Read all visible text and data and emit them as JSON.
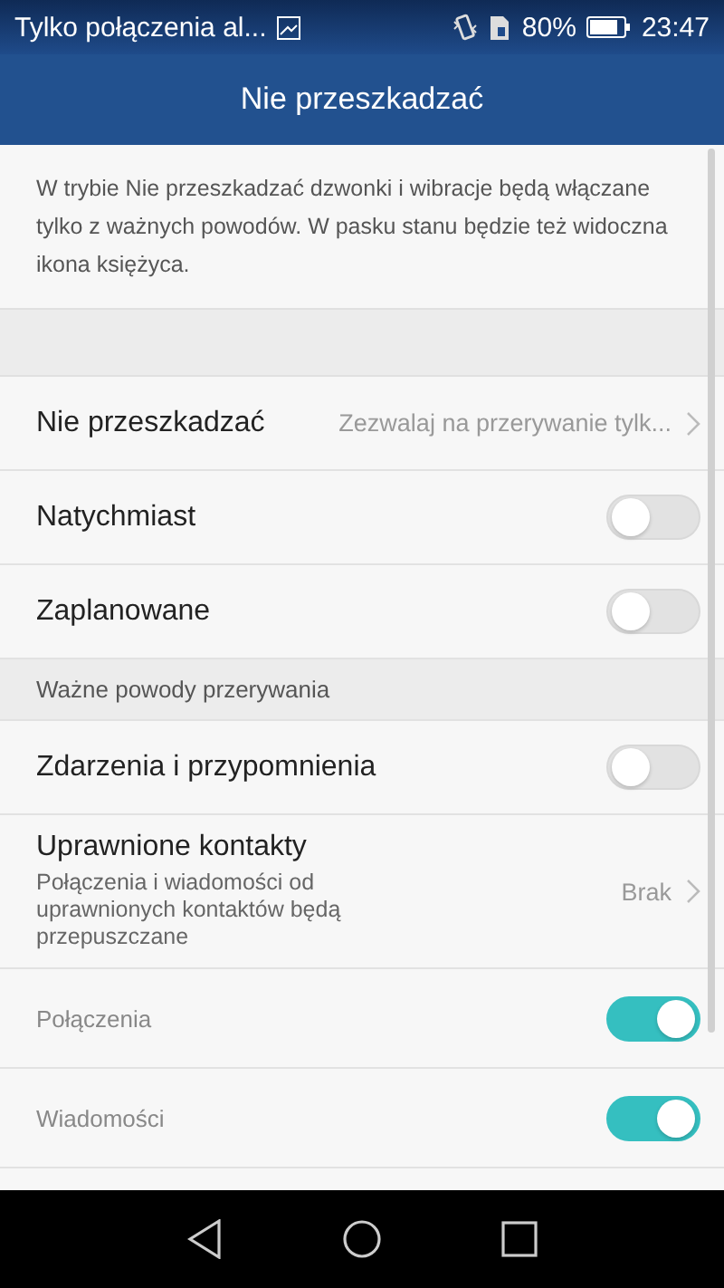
{
  "status_bar": {
    "notification": "Tylko połączenia al...",
    "battery": "80%",
    "time": "23:47"
  },
  "header": {
    "title": "Nie przeszkadzać"
  },
  "description": "W trybie Nie przeszkadzać dzwonki i wibracje będą włączane tylko z ważnych powodów. W pasku stanu będzie też widoczna ikona księżyca.",
  "rows": [
    {
      "kind": "spacer"
    },
    {
      "kind": "link",
      "label": "Nie przeszkadzać",
      "value": "Zezwalaj na przerywanie tylk..."
    },
    {
      "kind": "toggle",
      "label": "Natychmiast",
      "on": false
    },
    {
      "kind": "toggle",
      "label": "Zaplanowane",
      "on": false
    },
    {
      "kind": "header",
      "label": "Ważne powody przerywania"
    },
    {
      "kind": "toggle",
      "label": "Zdarzenia i przypomnienia",
      "on": false
    },
    {
      "kind": "link",
      "label": "Uprawnione kontakty",
      "sublabel": "Połączenia i wiadomości od uprawnionych kontaktów będą przepuszczane",
      "value": "Brak"
    },
    {
      "kind": "subtoggle",
      "label": "Połączenia",
      "on": true
    },
    {
      "kind": "subtoggle",
      "label": "Wiadomości",
      "on": true
    }
  ]
}
